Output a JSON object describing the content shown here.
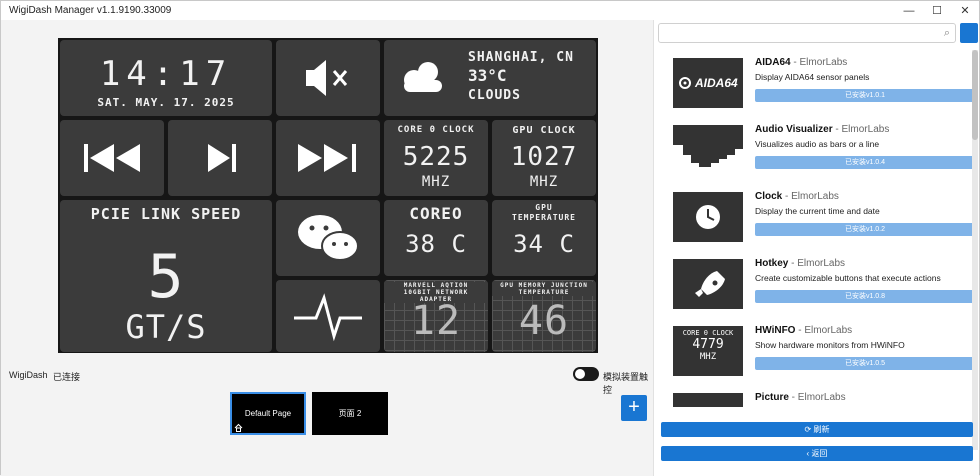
{
  "window": {
    "title": "WigiDash Manager v1.1.9190.33009"
  },
  "dashboard": {
    "clock": {
      "time": "14:17",
      "date": "SAT. MAY. 17. 2025"
    },
    "weather": {
      "city": "SHANGHAI, CN",
      "temp": "33°C",
      "condition": "CLOUDS"
    },
    "core_clock": {
      "label": "CORE 0 CLOCK",
      "value": "5225",
      "unit": "MHZ"
    },
    "gpu_clock": {
      "label": "GPU CLOCK",
      "value": "1027",
      "unit": "MHZ"
    },
    "pcie": {
      "label": "PCIE LINK SPEED",
      "value": "5",
      "unit": "GT/S"
    },
    "core0_temp": {
      "label": "COREO",
      "value": "38 C"
    },
    "gpu_temp": {
      "label": "GPU TEMPERATURE",
      "value": "34 C"
    },
    "nic": {
      "label": "MARVELL AQTION 10GBIT NETWORK ADAPTER",
      "value": "12"
    },
    "gpu_mem_temp": {
      "label": "GPU MEMORY JUNCTION TEMPERATURE",
      "value": "46"
    }
  },
  "status": {
    "device": "WigiDash",
    "connection": "已连接",
    "simulate_label": "模拟装置触控"
  },
  "pages": [
    {
      "label": "Default Page"
    },
    {
      "label": "页面 2"
    }
  ],
  "sidebar": {
    "search_placeholder": "",
    "plugins": [
      {
        "name": "AIDA64",
        "author": "ElmorLabs",
        "desc": "Display AIDA64 sensor panels",
        "button": "已安装v1.0.1",
        "thumb_text": "AIDA64"
      },
      {
        "name": "Audio Visualizer",
        "author": "ElmorLabs",
        "desc": "Visualizes audio as bars or a line",
        "button": "已安装v1.0.4",
        "thumb_text": ""
      },
      {
        "name": "Clock",
        "author": "ElmorLabs",
        "desc": "Display the current time and date",
        "button": "已安装v1.0.2",
        "thumb_text": ""
      },
      {
        "name": "Hotkey",
        "author": "ElmorLabs",
        "desc": "Create customizable buttons that execute actions",
        "button": "已安装v1.0.8",
        "thumb_text": ""
      },
      {
        "name": "HWiNFO",
        "author": "ElmorLabs",
        "desc": "Show hardware monitors from HWiNFO",
        "button": "已安装v1.0.5",
        "thumb_text": "CORE 0 CLOCK",
        "thumb_value": "4779",
        "thumb_unit": "MHZ"
      },
      {
        "name": "Picture",
        "author": "ElmorLabs",
        "desc": "",
        "button": "",
        "thumb_text": ""
      }
    ],
    "refresh_label": "刷新",
    "back_label": "返回",
    "author_sep": " - "
  }
}
